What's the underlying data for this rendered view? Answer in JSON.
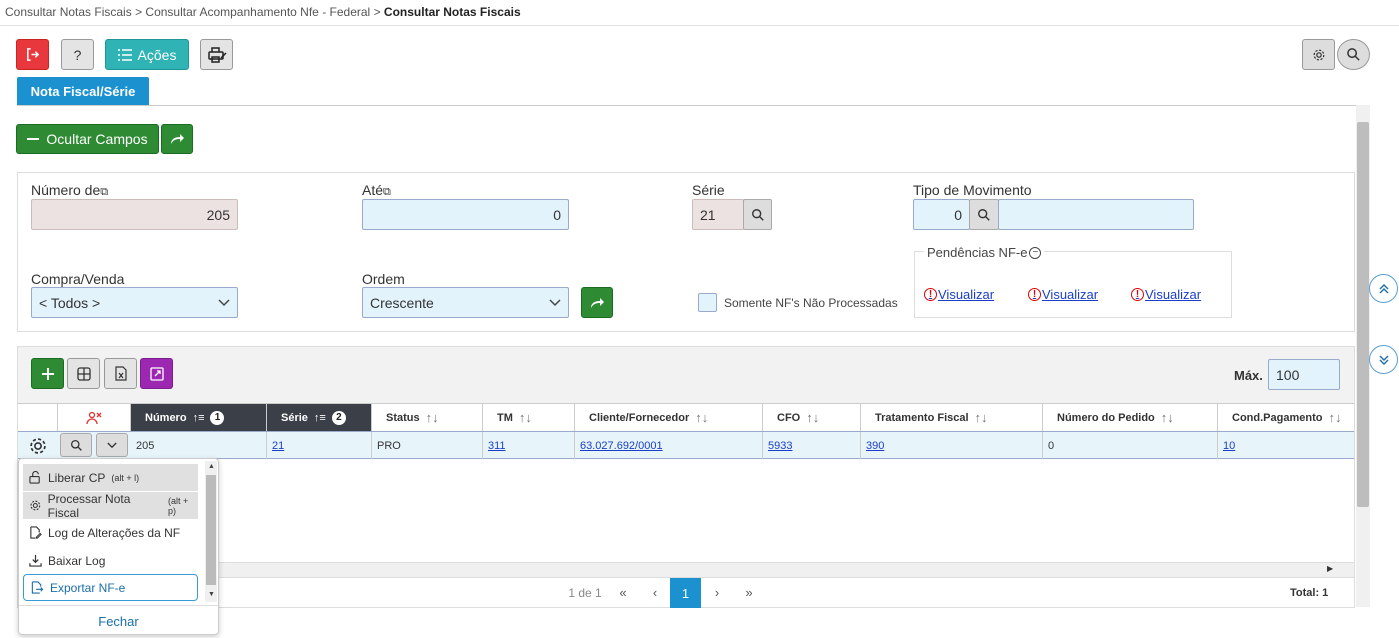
{
  "breadcrumb": {
    "item1": "Consultar Notas Fiscais",
    "sep1": ">",
    "item2": "Consultar Acompanhamento Nfe - Federal",
    "sep2": ">",
    "current": "Consultar Notas Fiscais"
  },
  "toolbar": {
    "help_label": "?",
    "acoes_label": "Ações"
  },
  "tabs": {
    "active": "Nota Fiscal/Série"
  },
  "form": {
    "ocultar_label": "Ocultar Campos",
    "numero_de_label": "Número de",
    "numero_de_value": "205",
    "ate_label": "Até",
    "ate_value": "0",
    "serie_label": "Série",
    "serie_value": "21",
    "tipo_mov_label": "Tipo de Movimento",
    "tipo_mov_value": "0",
    "tipo_mov_desc": "",
    "compra_venda_label": "Compra/Venda",
    "compra_venda_value": "< Todos >",
    "ordem_label": "Ordem",
    "ordem_value": "Crescente",
    "somente_label": "Somente NF's Não Processadas",
    "pendencias_label": "Pendências NF-e",
    "visualizar": [
      "Visualizar",
      "Visualizar",
      "Visualizar"
    ]
  },
  "grid": {
    "max_label": "Máx.",
    "max_value": "100",
    "columns": [
      "Número",
      "Série",
      "Status",
      "TM",
      "Cliente/Fornecedor",
      "CFO",
      "Tratamento Fiscal",
      "Número do Pedido",
      "Cond.Pagamento"
    ],
    "sort_badges": [
      "1",
      "2"
    ],
    "row": {
      "numero": "205",
      "serie": "21",
      "status": "PRO",
      "tm": "311",
      "cliente": "63.027.692/0001",
      "cfo": "5933",
      "tratamento": "390",
      "pedido": "0",
      "cond": "10"
    }
  },
  "menu": {
    "items": [
      {
        "label": "Liberar CP",
        "shortcut": "(alt + l)"
      },
      {
        "label": "Processar Nota Fiscal",
        "shortcut": "(alt + p)"
      },
      {
        "label": "Log de Alterações da NF",
        "shortcut": ""
      },
      {
        "label": "Baixar Log",
        "shortcut": ""
      },
      {
        "label": "Exportar NF-e",
        "shortcut": ""
      }
    ],
    "close_label": "Fechar"
  },
  "pager": {
    "info": "1 de 1",
    "current_page": "1",
    "total": "Total: 1"
  },
  "colors": {
    "accent": "#1b91d0",
    "green": "#2e8b34",
    "teal": "#2fb3b4",
    "red": "#e8383d",
    "purple": "#9c27b0"
  }
}
